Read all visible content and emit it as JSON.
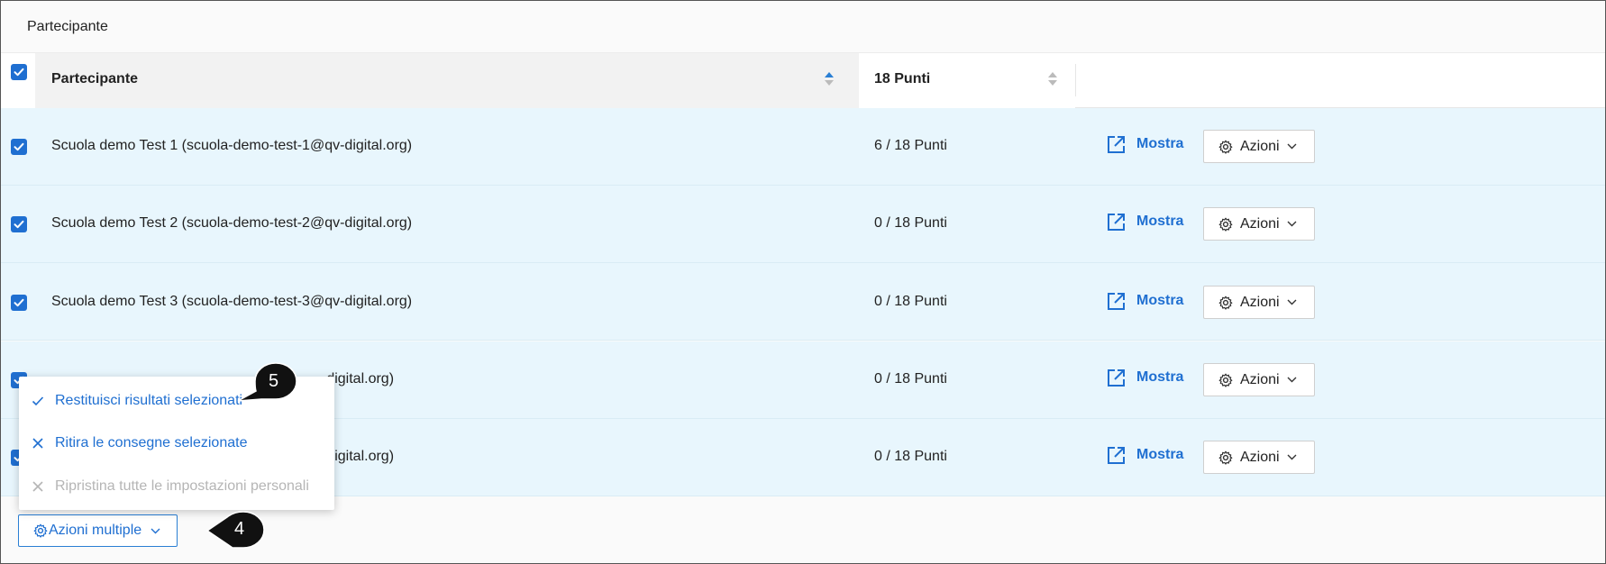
{
  "panel": {
    "title": "Partecipante"
  },
  "table": {
    "columns": {
      "name": "Partecipante",
      "points": "18 Punti"
    },
    "rows": [
      {
        "name": "Scuola demo Test 1 (scuola-demo-test-1@qv-digital.org)",
        "points": "6 / 18 Punti",
        "show_label": "Mostra",
        "actions_label": "Azioni"
      },
      {
        "name": "Scuola demo Test 2 (scuola-demo-test-2@qv-digital.org)",
        "points": "0 / 18 Punti",
        "show_label": "Mostra",
        "actions_label": "Azioni"
      },
      {
        "name": "Scuola demo Test 3 (scuola-demo-test-3@qv-digital.org)",
        "points": "0 / 18 Punti",
        "show_label": "Mostra",
        "actions_label": "Azioni"
      },
      {
        "name": "-digital.org)",
        "points": "0 / 18 Punti",
        "show_label": "Mostra",
        "actions_label": "Azioni"
      },
      {
        "name": "-digital.org)",
        "points": "0 / 18 Punti",
        "show_label": "Mostra",
        "actions_label": "Azioni"
      }
    ]
  },
  "bulk": {
    "button_label": "Azioni multiple",
    "menu": [
      {
        "label": "Restituisci risultati selezionati",
        "icon": "check-icon",
        "enabled": true
      },
      {
        "label": "Ritira le consegne selezionate",
        "icon": "close-icon",
        "enabled": true
      },
      {
        "label": "Ripristina tutte le impostazioni personali",
        "icon": "close-icon",
        "enabled": false
      }
    ]
  },
  "callouts": {
    "menu_step": "5",
    "button_step": "4"
  },
  "colors": {
    "accent": "#1f6fd1",
    "row_selected_bg": "#e8f6fd",
    "disabled_text": "#b5b5b5",
    "callout_bg": "#111111"
  }
}
